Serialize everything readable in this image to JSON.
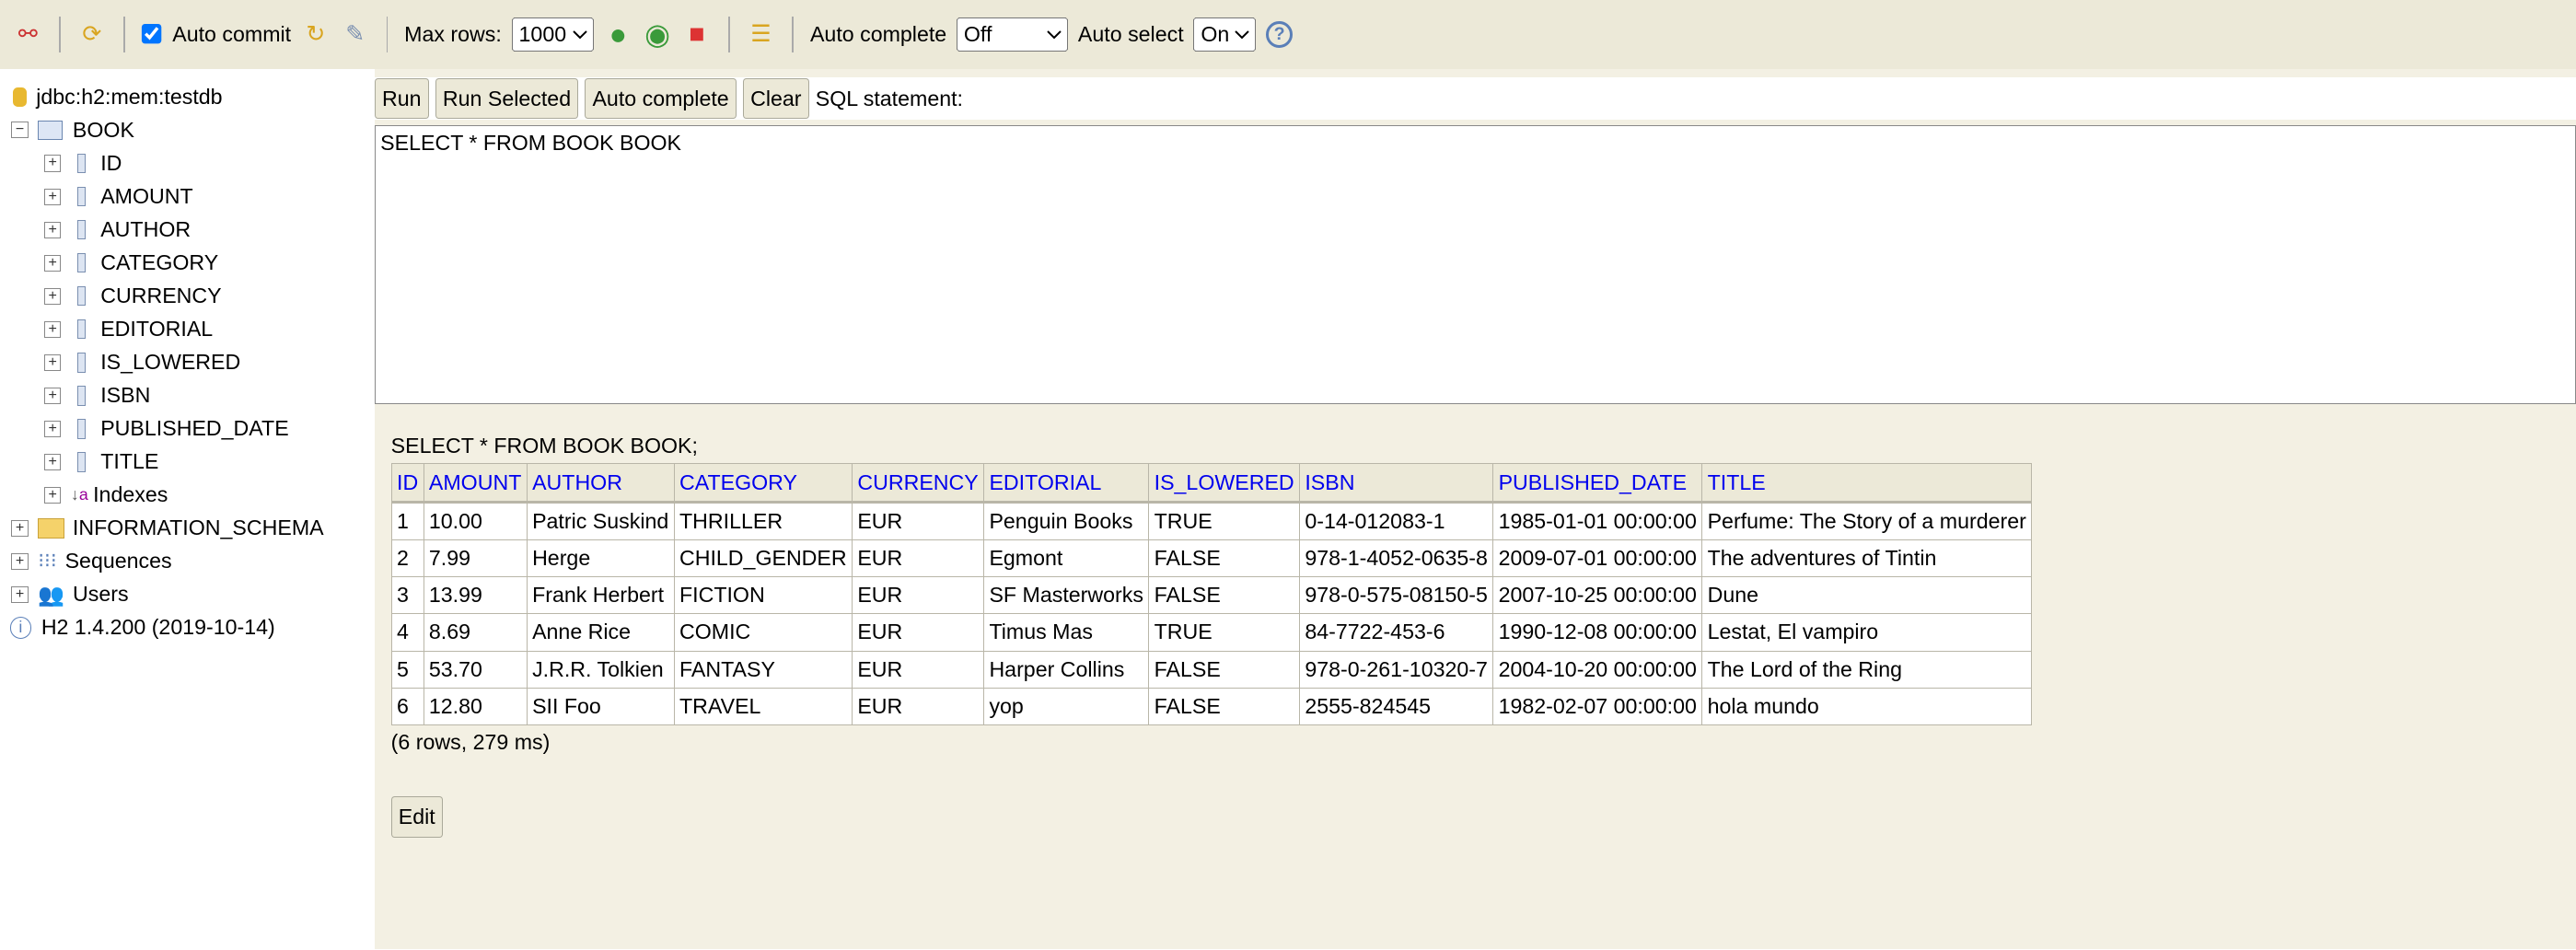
{
  "toolbar": {
    "auto_commit_label": "Auto commit",
    "auto_commit": true,
    "max_rows_label": "Max rows:",
    "max_rows": "1000",
    "auto_complete_label": "Auto complete",
    "auto_complete": "Off",
    "auto_select_label": "Auto select",
    "auto_select": "On",
    "help": "?"
  },
  "tree": {
    "connection": "jdbc:h2:mem:testdb",
    "table": "BOOK",
    "columns": [
      "ID",
      "AMOUNT",
      "AUTHOR",
      "CATEGORY",
      "CURRENCY",
      "EDITORIAL",
      "IS_LOWERED",
      "ISBN",
      "PUBLISHED_DATE",
      "TITLE"
    ],
    "indexes": "Indexes",
    "schema": "INFORMATION_SCHEMA",
    "sequences": "Sequences",
    "users": "Users",
    "version": "H2 1.4.200 (2019-10-14)"
  },
  "buttons": {
    "run": "Run",
    "run_selected": "Run Selected",
    "auto_complete": "Auto complete",
    "clear": "Clear",
    "sql_label": "SQL statement:"
  },
  "sql": "SELECT * FROM BOOK BOOK",
  "result": {
    "query": "SELECT * FROM BOOK BOOK;",
    "headers": [
      "ID",
      "AMOUNT",
      "AUTHOR",
      "CATEGORY",
      "CURRENCY",
      "EDITORIAL",
      "IS_LOWERED",
      "ISBN",
      "PUBLISHED_DATE",
      "TITLE"
    ],
    "rows": [
      [
        "1",
        "10.00",
        "Patric Suskind",
        "THRILLER",
        "EUR",
        "Penguin Books",
        "TRUE",
        "0-14-012083-1",
        "1985-01-01 00:00:00",
        "Perfume: The Story of a murderer"
      ],
      [
        "2",
        "7.99",
        "Herge",
        "CHILD_GENDER",
        "EUR",
        "Egmont",
        "FALSE",
        "978-1-4052-0635-8",
        "2009-07-01 00:00:00",
        "The adventures of Tintin"
      ],
      [
        "3",
        "13.99",
        "Frank Herbert",
        "FICTION",
        "EUR",
        "SF Masterworks",
        "FALSE",
        "978-0-575-08150-5",
        "2007-10-25 00:00:00",
        "Dune"
      ],
      [
        "4",
        "8.69",
        "Anne Rice",
        "COMIC",
        "EUR",
        "Timus Mas",
        "TRUE",
        "84-7722-453-6",
        "1990-12-08 00:00:00",
        "Lestat, El vampiro"
      ],
      [
        "5",
        "53.70",
        "J.R.R. Tolkien",
        "FANTASY",
        "EUR",
        "Harper Collins",
        "FALSE",
        "978-0-261-10320-7",
        "2004-10-20 00:00:00",
        "The Lord of the Ring"
      ],
      [
        "6",
        "12.80",
        "SII Foo",
        "TRAVEL",
        "EUR",
        "yop",
        "FALSE",
        "2555-824545",
        "1982-02-07 00:00:00",
        "hola mundo"
      ]
    ],
    "summary": "(6 rows, 279 ms)",
    "edit": "Edit"
  }
}
